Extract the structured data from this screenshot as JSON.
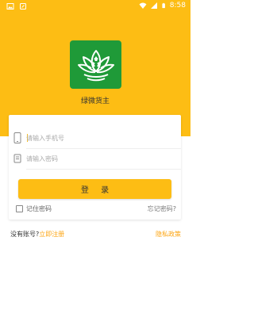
{
  "status_bar": {
    "time": "8:58",
    "left_icons": [
      "image-icon",
      "android-icon"
    ],
    "right_icons": [
      "wifi-icon",
      "signal-icon",
      "battery-icon"
    ]
  },
  "app": {
    "name": "绿微货主",
    "logo": "lotus-recycle-logo"
  },
  "form": {
    "phone_placeholder": "请输入手机号",
    "password_placeholder": "请输入密码",
    "phone_value": "",
    "password_value": "",
    "login_label": "登 录",
    "remember_label": "记住密码",
    "remember_checked": false,
    "forgot_label": "忘记密码?"
  },
  "footer": {
    "no_account": "没有账号?",
    "register_link": "立即注册",
    "privacy_link": "隐私政策"
  },
  "colors": {
    "accent": "#FDBD14",
    "logo_bg": "#1F9A38",
    "link": "#FDA614"
  }
}
